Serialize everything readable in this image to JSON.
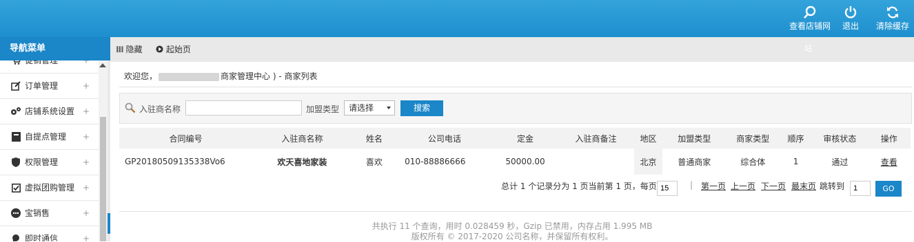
{
  "header": {
    "items": [
      {
        "label": "查看店铺网",
        "icon": "search-icon"
      },
      {
        "label": "退出",
        "icon": "power-icon"
      },
      {
        "label": "清除缓存",
        "icon": "refresh-icon"
      }
    ],
    "sub_label": "站"
  },
  "nav": {
    "title": "导航菜单",
    "items": [
      {
        "label": "促销管理",
        "icon": "cart-icon"
      },
      {
        "label": "订单管理",
        "icon": "edit-icon"
      },
      {
        "label": "店铺系统设置",
        "icon": "gears-icon"
      },
      {
        "label": "自提点管理",
        "icon": "book-icon"
      },
      {
        "label": "权限管理",
        "icon": "shield-icon"
      },
      {
        "label": "虚拟团购管理",
        "icon": "checkbox-icon"
      },
      {
        "label": "宝销售",
        "icon": "ellipsis-icon"
      },
      {
        "label": "即时通信",
        "icon": "chat-icon"
      }
    ],
    "expand_symbol": "+"
  },
  "tabs": {
    "hide": "隐藏",
    "home": "起始页"
  },
  "breadcrumb": {
    "prefix": "欢迎您，",
    "suffix": "商家管理中心 ) - 商家列表"
  },
  "search": {
    "name_label": "入驻商名称",
    "name_value": "",
    "type_label": "加盟类型",
    "type_selected": "请选择",
    "button": "搜索"
  },
  "table": {
    "headers": [
      "合同编号",
      "入驻商名称",
      "姓名",
      "公司电话",
      "定金",
      "入驻商备注",
      "地区",
      "加盟类型",
      "商家类型",
      "顺序",
      "审核状态",
      "操作"
    ],
    "rows": [
      [
        "GP20180509135338Vo6",
        "欢天喜地家装",
        "喜欢",
        "010-88886666",
        "50000.00",
        "",
        "北京",
        "普通商家",
        "综合体",
        "1",
        "通过",
        "查看"
      ]
    ]
  },
  "pagination": {
    "summary": "总计 1 个记录分为 1 页当前第 1 页，每页",
    "per_page": "15",
    "first": "第一页",
    "prev": "上一页",
    "next": "下一页",
    "last": "最末页",
    "jump_label": "跳转到",
    "jump_value": "1",
    "go": "GO"
  },
  "footer": {
    "line1": "共执行 11 个查询，用时 0.028459 秒，Gzip 已禁用，内存占用 1.995 MB",
    "line2": "版权所有 © 2017-2020 公司名称，并保留所有权利。"
  },
  "colors": {
    "primary": "#1b86c8",
    "topbar": "#2a9ad6"
  }
}
